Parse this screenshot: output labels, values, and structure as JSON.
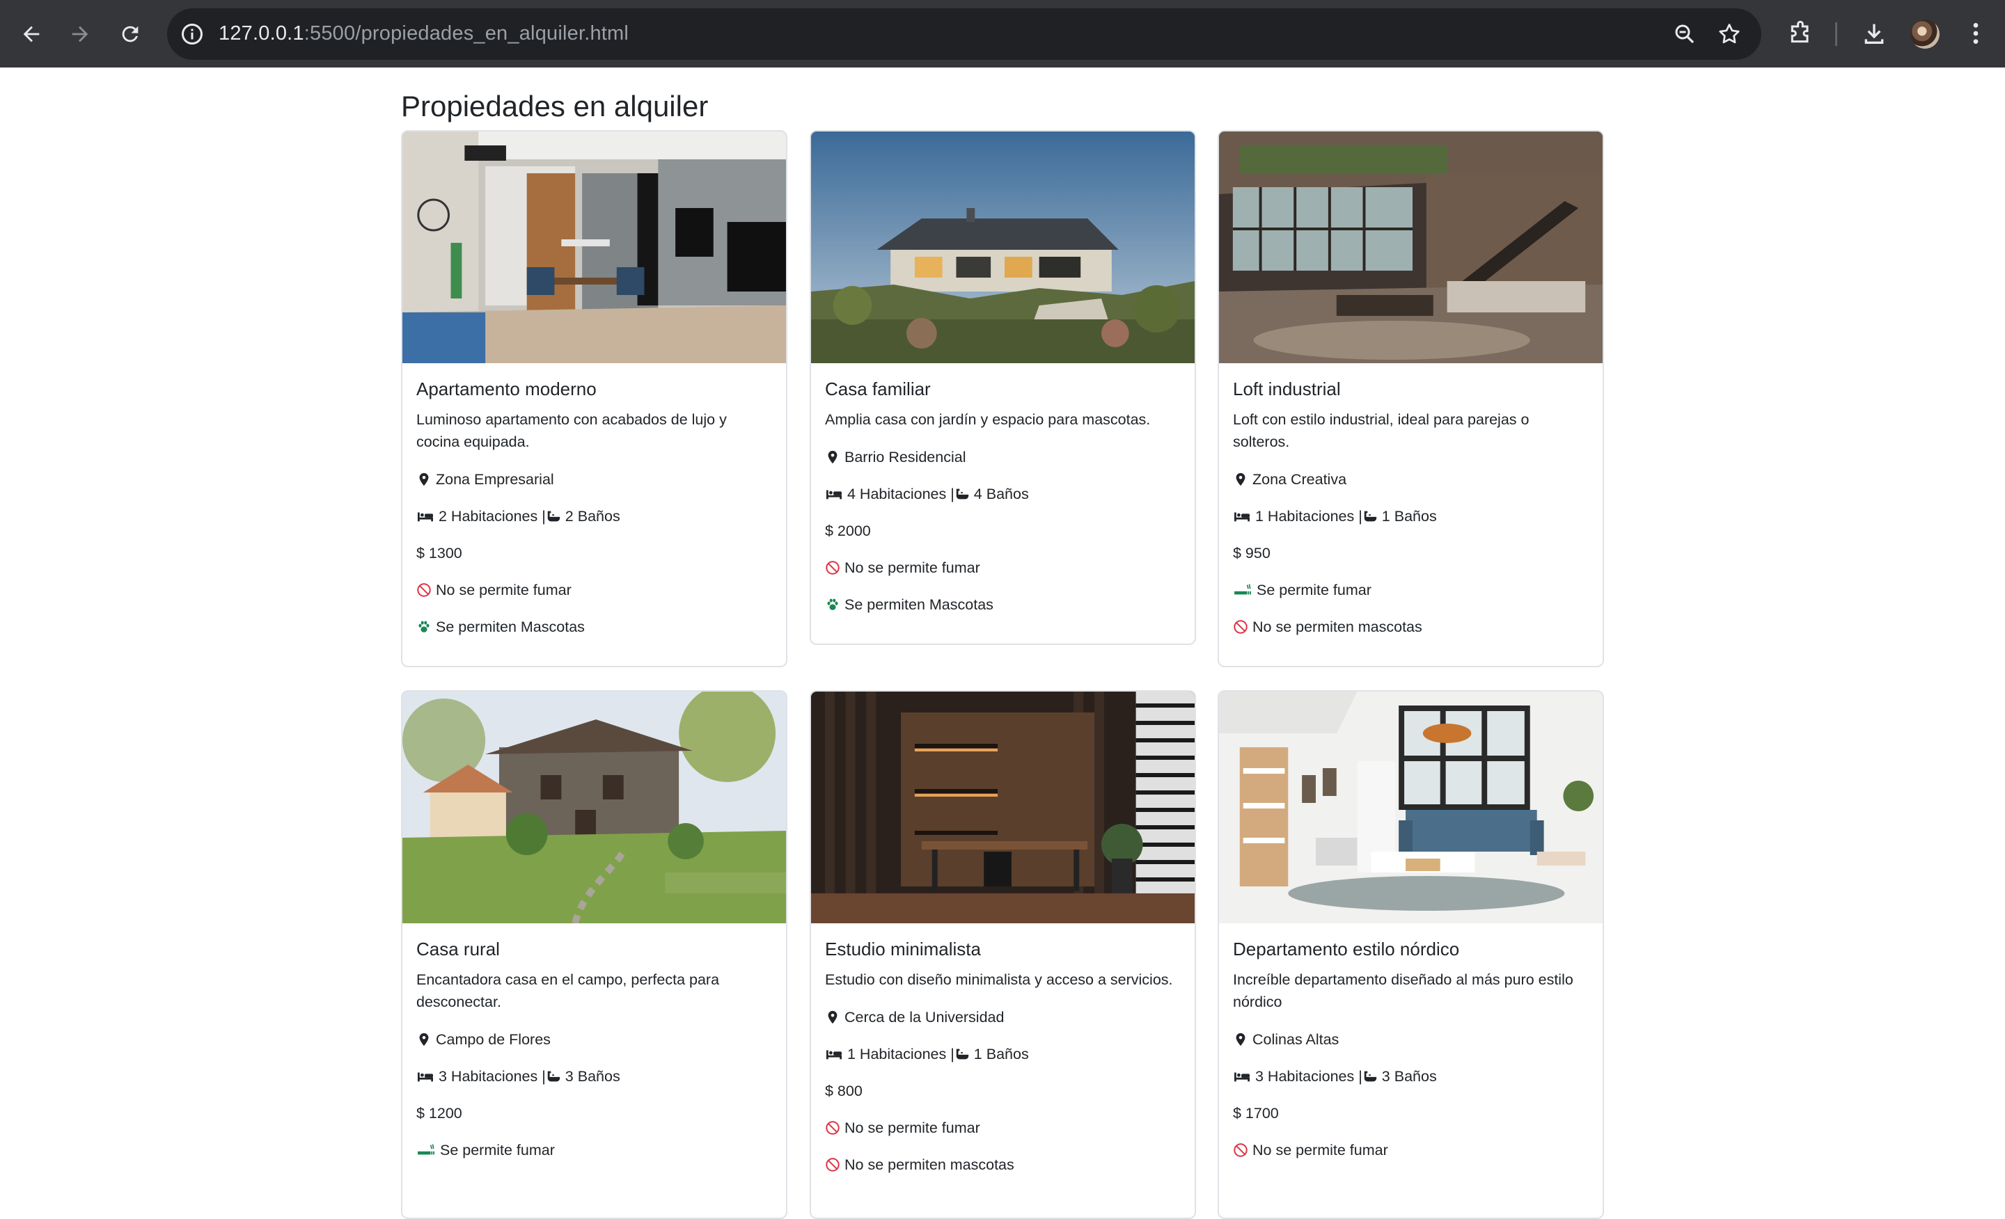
{
  "browser": {
    "url_host": "127.0.0.1",
    "url_rest": ":5500/propiedades_en_alquiler.html"
  },
  "page": {
    "title": "Propiedades en alquiler"
  },
  "colors": {
    "danger": "#dc3545",
    "success": "#198754",
    "chrome_bg": "#35363a",
    "omnibox_bg": "#202124"
  },
  "cards": [
    {
      "title": "Apartamento moderno",
      "description": "Luminoso apartamento con acabados de lujo y cocina equipada.",
      "location": "Zona Empresarial",
      "rooms": "2 Habitaciones | ",
      "baths": "2 Baños",
      "price": "$ 1300",
      "smoking": "No se permite fumar",
      "smoking_allowed": false,
      "pets": "Se permiten Mascotas",
      "pets_allowed": true
    },
    {
      "title": "Casa familiar",
      "description": "Amplia casa con jardín y espacio para mascotas.",
      "location": "Barrio Residencial",
      "rooms": "4 Habitaciones | ",
      "baths": "4 Baños",
      "price": "$ 2000",
      "smoking": "No se permite fumar",
      "smoking_allowed": false,
      "pets": "Se permiten Mascotas",
      "pets_allowed": true
    },
    {
      "title": "Loft industrial",
      "description": "Loft con estilo industrial, ideal para parejas o solteros.",
      "location": "Zona Creativa",
      "rooms": "1 Habitaciones | ",
      "baths": "1 Baños",
      "price": "$ 950",
      "smoking": "Se permite fumar",
      "smoking_allowed": true,
      "pets": "No se permiten mascotas",
      "pets_allowed": false
    },
    {
      "title": "Casa rural",
      "description": "Encantadora casa en el campo, perfecta para desconectar.",
      "location": "Campo de Flores",
      "rooms": "3 Habitaciones | ",
      "baths": "3 Baños",
      "price": "$ 1200",
      "smoking": "Se permite fumar",
      "smoking_allowed": true,
      "pets": "",
      "pets_allowed": null
    },
    {
      "title": "Estudio minimalista",
      "description": "Estudio con diseño minimalista y acceso a servicios.",
      "location": "Cerca de la Universidad",
      "rooms": "1 Habitaciones | ",
      "baths": "1 Baños",
      "price": "$ 800",
      "smoking": "No se permite fumar",
      "smoking_allowed": false,
      "pets": "No se permiten mascotas",
      "pets_allowed": false
    },
    {
      "title": "Departamento estilo nórdico",
      "description": "Increíble departamento diseñado al más puro estilo nórdico",
      "location": "Colinas Altas",
      "rooms": "3 Habitaciones | ",
      "baths": "3 Baños",
      "price": "$ 1700",
      "smoking": "No se permite fumar",
      "smoking_allowed": false,
      "pets": "",
      "pets_allowed": null
    }
  ]
}
